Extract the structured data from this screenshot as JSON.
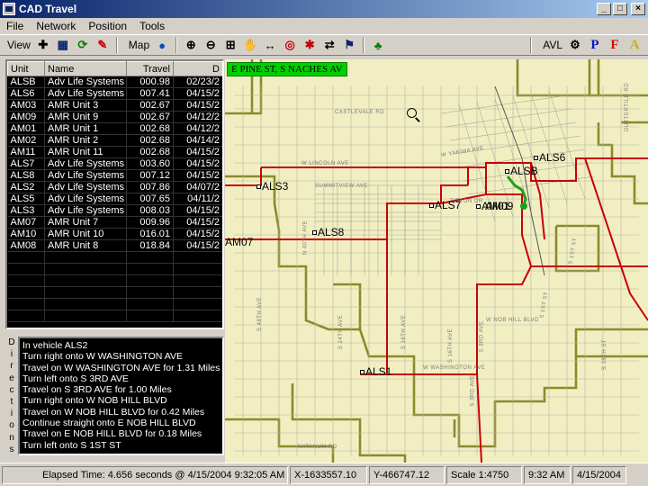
{
  "window": {
    "title": "CAD Travel",
    "minimize": "_",
    "maximize": "□",
    "close": "×"
  },
  "menu": [
    "File",
    "Network",
    "Position",
    "Tools"
  ],
  "toolbar": {
    "view_label": "View",
    "map_label": "Map",
    "avl_label": "AVL",
    "p_label": "P",
    "f_label": "F",
    "a_label": "A"
  },
  "unit_list": {
    "columns": [
      "Unit",
      "Name",
      "Travel",
      "D"
    ],
    "rows": [
      [
        "ALSB",
        "Adv Life Systems ...",
        "000.98",
        "02/23/2"
      ],
      [
        "ALS6",
        "Adv Life Systems 6",
        "007.41",
        "04/15/2"
      ],
      [
        "AM03",
        "AMR Unit 3",
        "002.67",
        "04/15/2"
      ],
      [
        "AM09",
        "AMR Unit 9",
        "002.67",
        "04/12/2"
      ],
      [
        "AM01",
        "AMR Unit 1",
        "002.68",
        "04/12/2"
      ],
      [
        "AM02",
        "AMR Unit 2",
        "002.68",
        "04/14/2"
      ],
      [
        "AM11",
        "AMR Unit 11",
        "002.68",
        "04/15/2"
      ],
      [
        "ALS7",
        "Adv Life Systems 7",
        "003.60",
        "04/15/2"
      ],
      [
        "ALS8",
        "Adv Life Systems 8",
        "007.12",
        "04/15/2"
      ],
      [
        "ALS2",
        "Adv Life Systems 2",
        "007.86",
        "04/07/2"
      ],
      [
        "ALS5",
        "Adv Life Systems 5",
        "007.65",
        "04/11/2"
      ],
      [
        "ALS3",
        "Adv Life Systems 3",
        "008.03",
        "04/15/2"
      ],
      [
        "AM07",
        "AMR Unit 7",
        "009.96",
        "04/15/2"
      ],
      [
        "AM10",
        "AMR Unit 10",
        "016.01",
        "04/15/2"
      ],
      [
        "AM08",
        "AMR Unit 8",
        "018.84",
        "04/15/2"
      ]
    ]
  },
  "directions": {
    "side_label": [
      "D",
      "i",
      "r",
      "e",
      "c",
      "t",
      "i",
      "o",
      "n",
      "s"
    ],
    "lines": [
      "In vehicle ALS2",
      "Turn right onto W WASHINGTON AVE",
      "Travel on W WASHINGTON AVE for 1.31 Miles",
      "Turn left onto S 3RD AVE",
      "Travel on S 3RD AVE for 1.00 Miles",
      "Turn right onto W NOB HILL BLVD",
      "Travel on W NOB HILL BLVD for 0.42 Miles",
      "Continue straight onto E NOB HILL BLVD",
      "Travel on E NOB HILL BLVD for 0.18 Miles",
      "Turn left onto S 1ST ST"
    ]
  },
  "map": {
    "banner": "E PINE ST, S NACHES AV",
    "units": [
      "ALS6",
      "ALSB",
      "ALS3",
      "ALS7",
      "AM01",
      "AM09",
      "ALS8",
      "AM07",
      "ALS1"
    ],
    "streets": [
      "CASTLEVALE RD",
      "W LINCOLN AVE",
      "W YAKIMA AVE",
      "SUMMITVIEW AVE",
      "TIETON DR",
      "W NOB HILL BLVD",
      "W WASHINGTON AVE",
      "S 16TH AVE",
      "S 3RD AVE",
      "S 1ST ST",
      "AHTANUM RD",
      "N 40TH AVE",
      "DUTTERTILD RD",
      "S 48TH AVE",
      "S 24TH AVE",
      "S 16TH AVE",
      "S 3RD AVE",
      "S 1ST ST",
      "S 18TH ST"
    ]
  },
  "status": {
    "elapsed": "Elapsed Time: 4.656 seconds @ 4/15/2004 9:32:05 AM",
    "x": "X-1633557.10",
    "y": "Y-466747.12",
    "scale": "Scale 1:4750",
    "time": "9:32 AM",
    "date": "4/15/2004"
  },
  "colors": {
    "route": "#c8000a",
    "boundary": "#8c8a2a",
    "map_bg": "#f1efc2",
    "banner": "#00d000",
    "highlight_route": "#1aa11a"
  }
}
